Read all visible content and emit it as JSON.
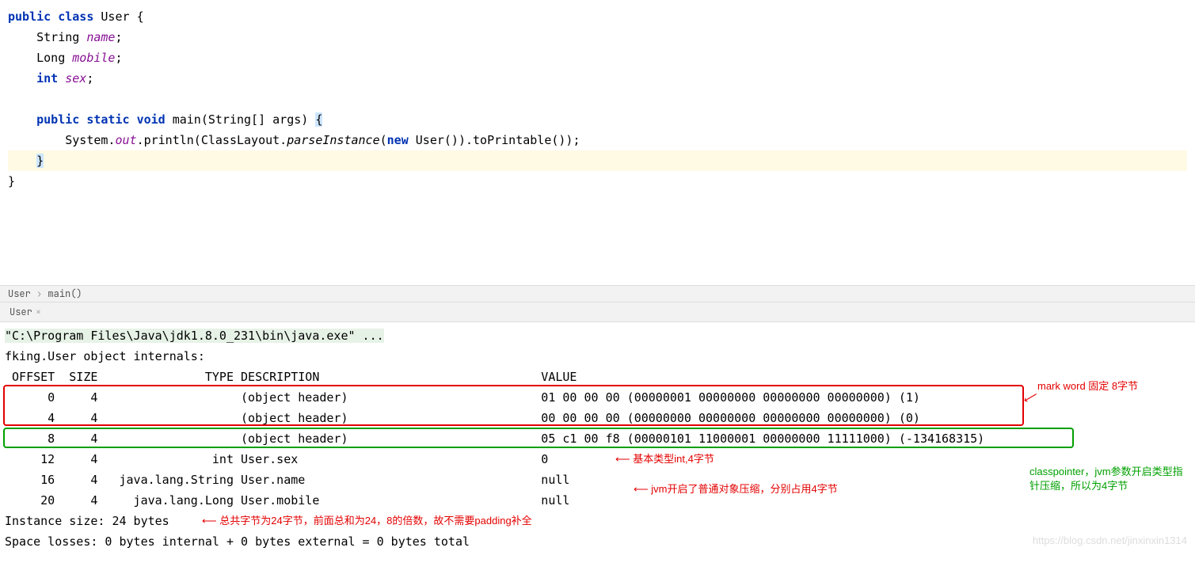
{
  "editor": {
    "l1_kw1": "public",
    "l1_kw2": "class",
    "l1_name": "User",
    "l1_brace": "{",
    "l2_type": "String",
    "l2_name": "name",
    "l2_end": ";",
    "l3_type": "Long",
    "l3_name": "mobile",
    "l3_end": ";",
    "l4_kw": "int",
    "l4_name": "sex",
    "l4_end": ";",
    "l5_kw1": "public",
    "l5_kw2": "static",
    "l5_kw3": "void",
    "l5_name": "main",
    "l5_args": "(String[] args) ",
    "l5_brace": "{",
    "l6_a": "System.",
    "l6_out": "out",
    "l6_b": ".println(ClassLayout.",
    "l6_parse": "parseInstance",
    "l6_c": "(",
    "l6_new": "new",
    "l6_d": " User()).toPrintable());",
    "l7_brace": "}",
    "l8_brace": "}"
  },
  "breadcrumb": {
    "item1": "User",
    "item2": "main()"
  },
  "tab": {
    "name": "User",
    "close": "×"
  },
  "console": {
    "cmd": "\"C:\\Program Files\\Java\\jdk1.8.0_231\\bin\\java.exe\" ...",
    "title": "fking.User object internals:",
    "header": " OFFSET  SIZE               TYPE DESCRIPTION                               VALUE",
    "rows": [
      "      0     4                    (object header)                           01 00 00 00 (00000001 00000000 00000000 00000000) (1)",
      "      4     4                    (object header)                           00 00 00 00 (00000000 00000000 00000000 00000000) (0)",
      "      8     4                    (object header)                           05 c1 00 f8 (00000101 11000001 00000000 11111000) (-134168315)",
      "     12     4                int User.sex                                  0",
      "     16     4   java.lang.String User.name                                 null",
      "     20     4     java.lang.Long User.mobile                               null"
    ],
    "footer1": "Instance size: 24 bytes",
    "footer2": "Space losses: 0 bytes internal + 0 bytes external = 0 bytes total"
  },
  "annotations": {
    "markword": "mark word 固定 8字节",
    "classptr": "classpointer，jvm参数开启类型指针压缩，所以为4字节",
    "intfield": "基本类型int,4字节",
    "objfield": "jvm开启了普通对象压缩，分别占用4字节",
    "instsize": "总共字节为24字节，前面总和为24，8的倍数，故不需要padding补全",
    "arrowL": "⟵",
    "arrowR": "⟶"
  },
  "watermark": "https://blog.csdn.net/jinxinxin1314"
}
